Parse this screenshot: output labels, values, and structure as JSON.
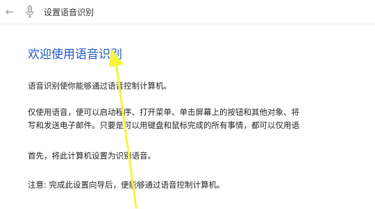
{
  "window": {
    "back_glyph": "←",
    "mic_icon": "microphone-icon",
    "title": "设置语音识别"
  },
  "content": {
    "heading": "欢迎使用语音识别",
    "intro": "语音识别使你能够通过语音控制计算机。",
    "detail_line1": "仅使用语音，便可以启动程序、打开菜单、单击屏幕上的按钮和其他对象、将",
    "detail_line2": "写和发送电子邮件。只要是可以用键盘和鼠标完成的所有事情，都可以仅用语",
    "first_step": "首先，将此计算机设置为识别语音。",
    "note": "注意: 完成此设置向导后，便能够通过语音控制计算机。"
  },
  "colors": {
    "heading": "#1f58c3",
    "annotation_arrow": "#f5f53a"
  }
}
